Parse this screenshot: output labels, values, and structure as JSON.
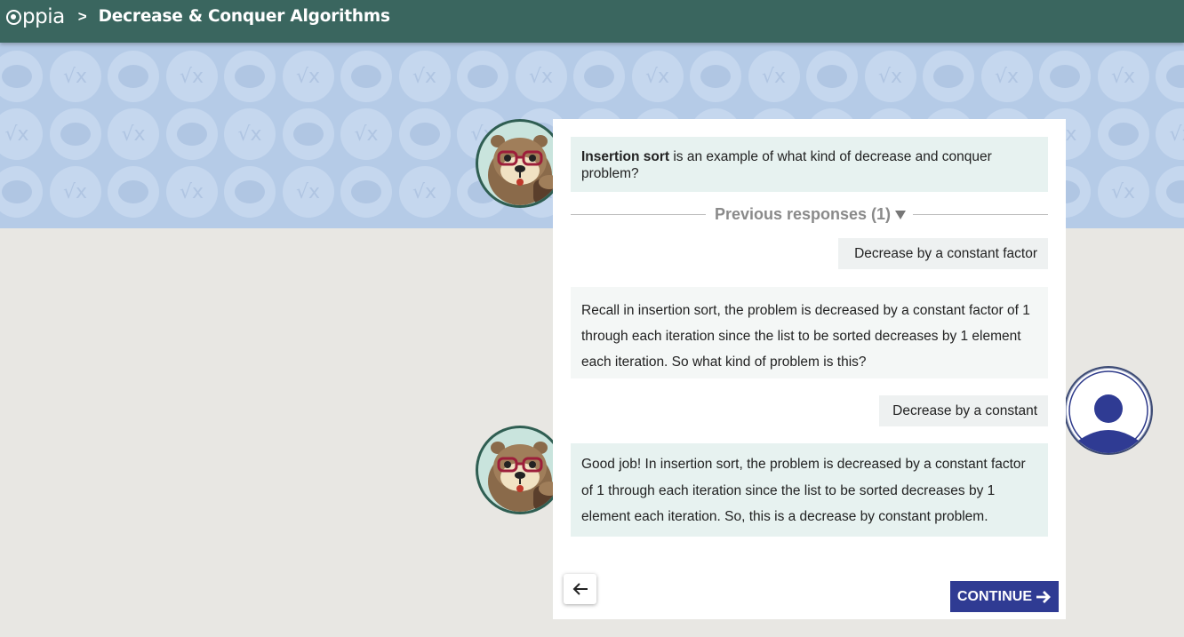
{
  "header": {
    "logo_text": "ppia",
    "breadcrumb_separator": ">",
    "topic_title": "Decrease & Conquer Algorithms"
  },
  "banner": {
    "pattern_glyph": "√x"
  },
  "conversation": {
    "question": {
      "bold": "Insertion sort",
      "rest": " is an example of what kind of decrease and conquer problem?"
    },
    "previous_responses_label": "Previous responses (1)",
    "previous_answer": "Decrease by a constant factor",
    "hint_feedback": "Recall in insertion sort, the problem is decreased by a constant factor of 1 through each iteration since the list to be sorted decreases by 1 element each iteration. So what kind of problem is this?",
    "learner_answer": "Decrease by a constant",
    "final_feedback": "Good job! In insertion sort, the problem is decreased by a constant factor of 1 through each iteration since the list to be sorted decreases by 1 element each iteration. So, this is a decrease by constant problem."
  },
  "controls": {
    "continue_label": "CONTINUE"
  },
  "colors": {
    "navbar": "#3a665f",
    "banner": "#b5cbe7",
    "continue_button": "#2f3b93",
    "tutor_bubble": "#e7f2f0"
  },
  "icons": [
    "oppia-logo-icon",
    "caret-down-icon",
    "back-arrow-icon",
    "arrow-right-icon",
    "tutor-otter-avatar",
    "learner-avatar-icon"
  ]
}
